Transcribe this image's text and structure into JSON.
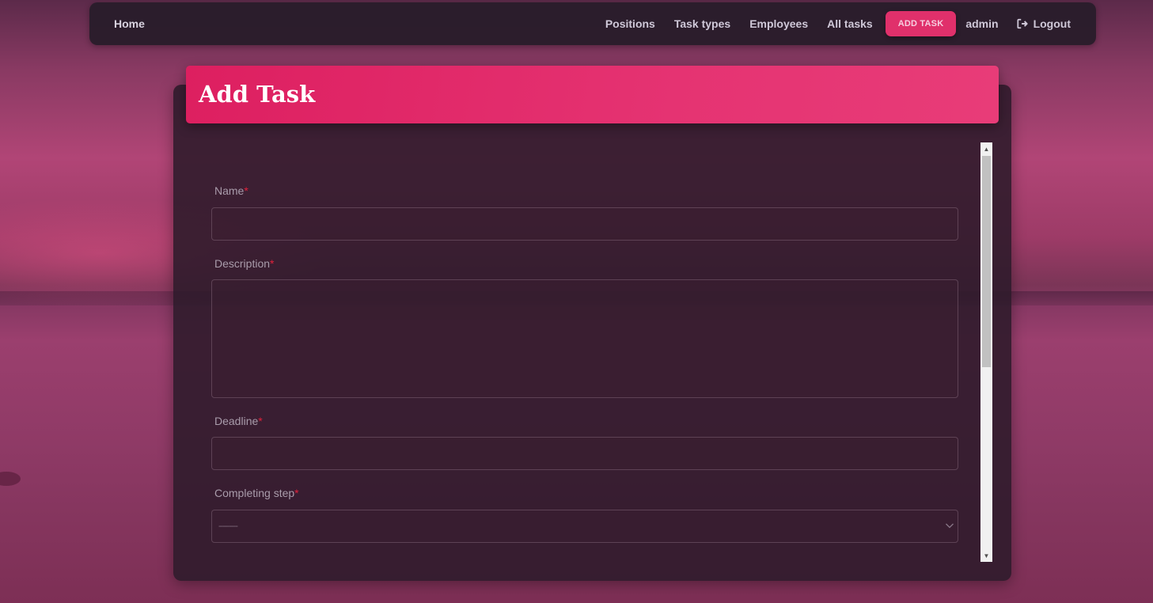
{
  "navbar": {
    "home": "Home",
    "links": [
      "Positions",
      "Task types",
      "Employees",
      "All tasks"
    ],
    "add_task": "ADD TASK",
    "user": "admin",
    "logout": "Logout"
  },
  "page": {
    "title": "Add Task"
  },
  "form": {
    "required_mark": "*",
    "name_label": "Name",
    "name_value": "",
    "description_label": "Description",
    "description_value": "",
    "deadline_label": "Deadline",
    "deadline_value": "",
    "step_label": "Completing step",
    "step_selected": "---------"
  },
  "colors": {
    "accent": "#e0306b",
    "required": "#e0213b"
  },
  "icons": {
    "logout": "logout-icon",
    "select": "chevron-down-icon",
    "scroll_up": "arrow-up-icon",
    "scroll_down": "arrow-down-icon"
  }
}
